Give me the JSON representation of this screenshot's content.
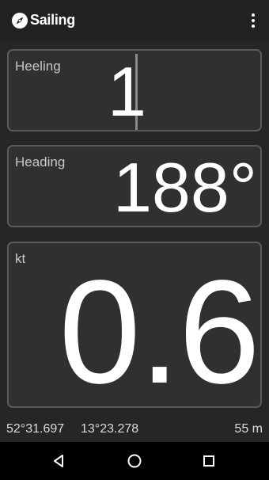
{
  "app_bar": {
    "title": "Sailing",
    "icon": "compass-icon",
    "menu_icon": "overflow-menu-icon"
  },
  "heeling": {
    "label": "Heeling",
    "value": "1"
  },
  "heading": {
    "label": "Heading",
    "value": "188°"
  },
  "speed": {
    "label": "kt",
    "value": "0.6"
  },
  "status": {
    "latitude": "52°31.697",
    "longitude": "13°23.278",
    "altitude": "55 m"
  },
  "nav": {
    "back_icon": "back-triangle-icon",
    "home_icon": "home-circle-icon",
    "recents_icon": "recents-square-icon"
  },
  "colors": {
    "background": "#262626",
    "panel": "#303030",
    "panel_border": "#5a5a5a",
    "label": "#c8c8c8",
    "value": "#ffffff"
  }
}
